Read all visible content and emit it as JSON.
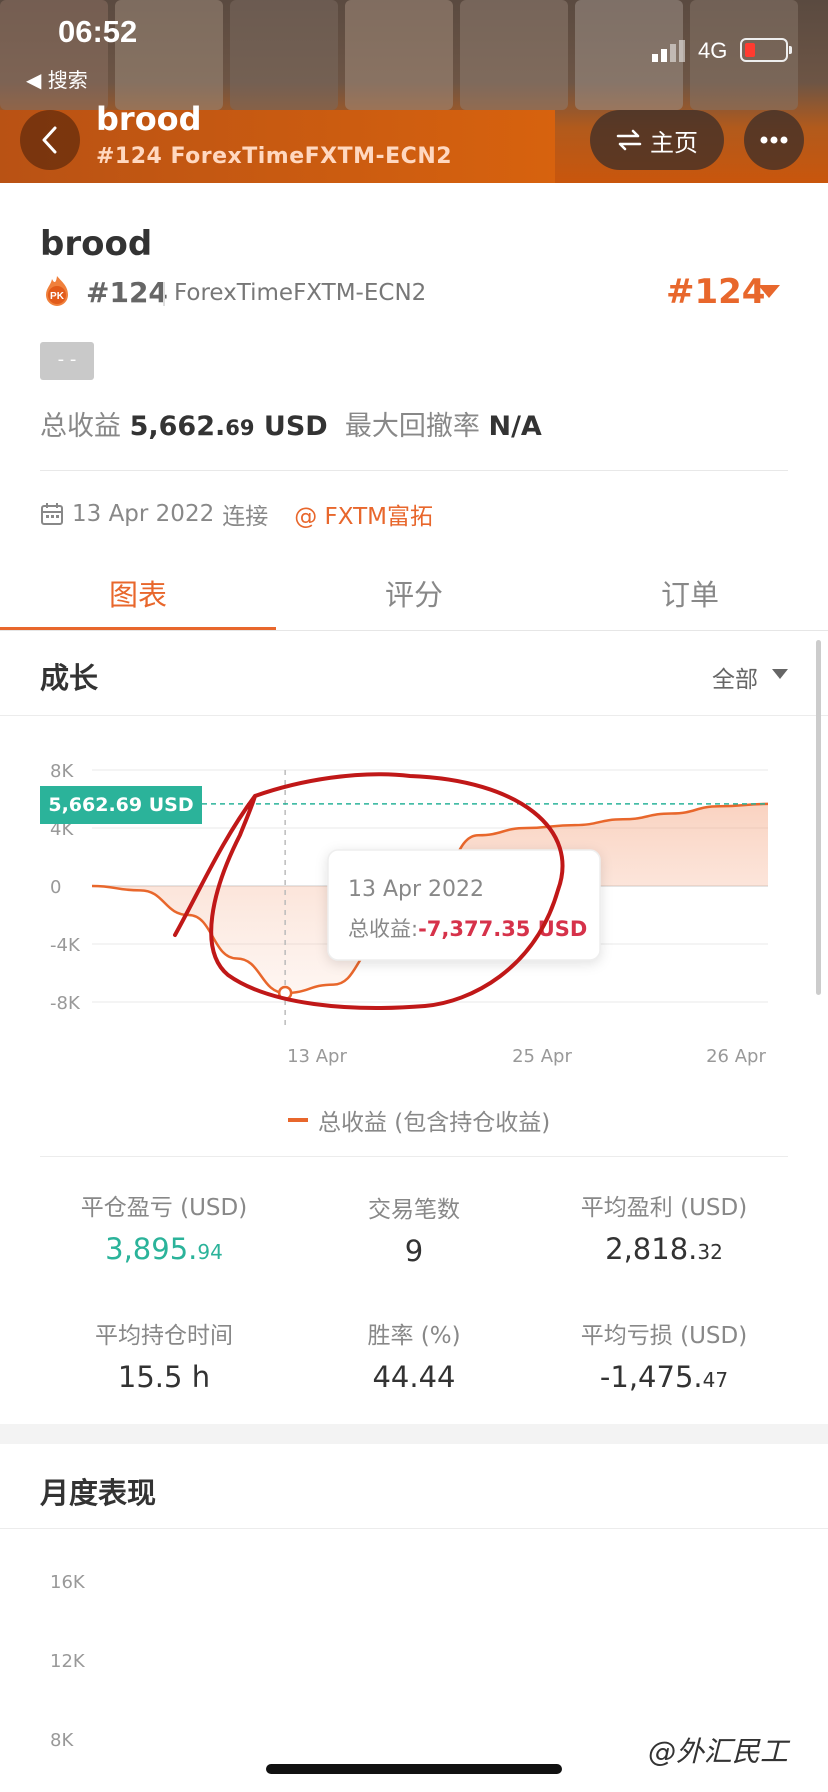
{
  "status_bar": {
    "time": "06:52",
    "back_app": "◀ 搜索",
    "network": "4G"
  },
  "header": {
    "title": "brood",
    "subtitle": "#124 ForexTimeFXTM-ECN2",
    "home_label": "主页"
  },
  "profile": {
    "name": "brood",
    "rank": "#124",
    "server": "ForexTimeFXTM-ECN2",
    "rank_big": "#124",
    "tag": "- -",
    "total_profit_label": "总收益",
    "total_profit_main": "5,662.",
    "total_profit_dec": "69",
    "total_profit_unit": "USD",
    "max_drawdown_label": "最大回撤率",
    "max_drawdown_value": "N/A",
    "connected_date": "13 Apr 2022",
    "connected_label": "连接",
    "broker": "@ FXTM富拓"
  },
  "tabs": [
    "图表",
    "评分",
    "订单"
  ],
  "growth": {
    "title": "成长",
    "filter": "全部"
  },
  "chart_data": {
    "type": "area",
    "y_ticks": [
      "8K",
      "4K",
      "0",
      "-4K",
      "-8K"
    ],
    "x_ticks": [
      "13 Apr",
      "25 Apr",
      "26 Apr"
    ],
    "ylim": [
      -8000,
      8000
    ],
    "series": [
      {
        "name": "总收益 (包含持仓收益)",
        "x": [
          0,
          1,
          2,
          3,
          4,
          5,
          6,
          7,
          8,
          9,
          10,
          11,
          12,
          13,
          14
        ],
        "values": [
          0,
          -300,
          -2000,
          -5000,
          -7377.35,
          -6800,
          -4000,
          0,
          3500,
          4000,
          4200,
          4600,
          5000,
          5500,
          5662.69
        ]
      }
    ],
    "current_value_label": "5,662.69 USD",
    "tooltip": {
      "date": "13 Apr 2022",
      "label": "总收益:",
      "value": "-7,377.35 USD"
    }
  },
  "legend": "总收益 (包含持仓收益)",
  "stats": [
    {
      "label": "平仓盈亏 (USD)",
      "main": "3,895.",
      "dec": "94",
      "color": "#2bb39a"
    },
    {
      "label": "交易笔数",
      "main": "9",
      "dec": "",
      "color": "#333333"
    },
    {
      "label": "平均盈利 (USD)",
      "main": "2,818.",
      "dec": "32",
      "color": "#333333"
    },
    {
      "label": "平均持仓时间",
      "main": "15.5 h",
      "dec": "",
      "color": "#333333"
    },
    {
      "label": "胜率 (%)",
      "main": "44.44",
      "dec": "",
      "color": "#333333"
    },
    {
      "label": "平均亏损 (USD)",
      "main": "-1,475.",
      "dec": "47",
      "color": "#333333"
    }
  ],
  "monthly": {
    "title": "月度表现",
    "y_ticks": [
      "16K",
      "12K",
      "8K"
    ]
  },
  "watermark": "@外汇民工",
  "colors": {
    "accent": "#e8672c",
    "positive": "#2bb39a",
    "negative": "#d6324a",
    "annotation": "#c01818"
  }
}
